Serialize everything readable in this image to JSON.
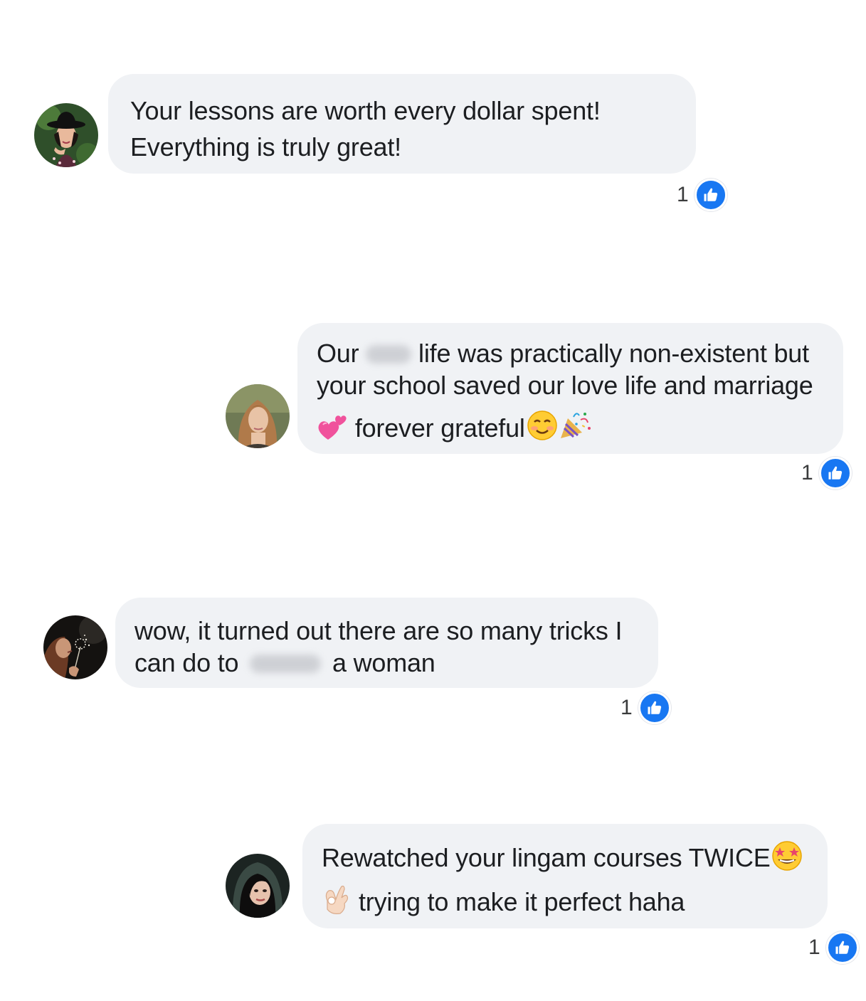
{
  "colors": {
    "bubble_bg": "#f0f2f5",
    "text": "#1c1e21",
    "like_blue": "#1877f2",
    "count_text": "#3a3b3c"
  },
  "comments": [
    {
      "avatar_icon": "avatar-woman-black-hat",
      "lines": [
        "Your lessons are worth every dollar spent!",
        "Everything is truly great!"
      ],
      "reaction_count": "1",
      "reaction_icon": "like-icon"
    },
    {
      "avatar_icon": "avatar-woman-light-hair",
      "line1_start": "Our",
      "line1_end": "life was practically non-existent but",
      "line2": "your school saved our love life and marriage",
      "line3_text": "forever grateful",
      "emojis": [
        "two-hearts-emoji",
        "smiling-face-emoji",
        "party-popper-emoji"
      ],
      "reaction_count": "1",
      "reaction_icon": "like-icon"
    },
    {
      "avatar_icon": "avatar-woman-dandelion",
      "line1": "wow, it turned out there are so many tricks I",
      "line2_start": "can do to",
      "line2_end": "a woman",
      "reaction_count": "1",
      "reaction_icon": "like-icon"
    },
    {
      "avatar_icon": "avatar-woman-hood",
      "line1": "Rewatched your lingam courses TWICE",
      "line2": "trying to make it perfect haha",
      "emojis": [
        "star-struck-emoji",
        "ok-hand-emoji"
      ],
      "reaction_count": "1",
      "reaction_icon": "like-icon"
    }
  ]
}
